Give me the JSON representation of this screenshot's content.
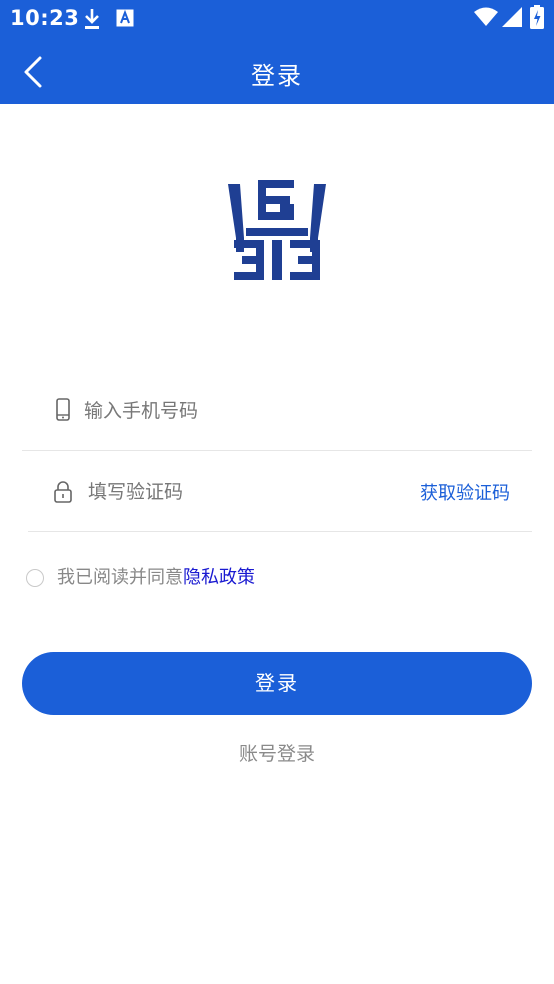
{
  "status_bar": {
    "time": "10:23",
    "icons": [
      "download-icon",
      "font-a-icon",
      "wifi-icon",
      "signal-icon",
      "battery-icon"
    ]
  },
  "header": {
    "title": "登录",
    "back_icon": "chevron-left-icon"
  },
  "logo": {
    "icon": "brand-logo-icon",
    "color": "#1f3f93"
  },
  "form": {
    "phone": {
      "placeholder": "输入手机号码",
      "value": "",
      "icon": "phone-icon"
    },
    "code": {
      "placeholder": "填写验证码",
      "value": "",
      "icon": "lock-icon",
      "get_code_label": "获取验证码"
    }
  },
  "agreement": {
    "checked": false,
    "text": "我已阅读并同意",
    "link_text": "隐私政策"
  },
  "login_button": {
    "label": "登录"
  },
  "account_login": {
    "label": "账号登录"
  },
  "colors": {
    "primary": "#1b5fd8",
    "link": "#1a1ad1",
    "placeholder": "#777777"
  }
}
